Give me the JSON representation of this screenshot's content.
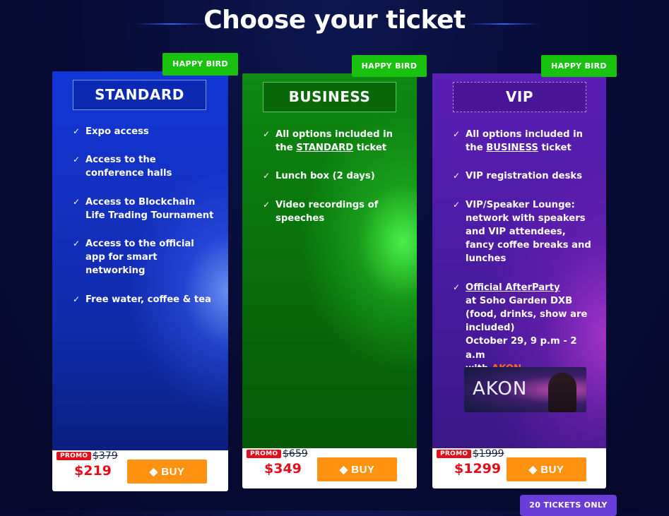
{
  "page": {
    "title": "Choose your ticket"
  },
  "badges": {
    "happy_bird": "HAPPY BIRD"
  },
  "tickets": [
    {
      "tier": "STANDARD",
      "features": [
        {
          "text": "Expo access"
        },
        {
          "text": "Access to the conference halls"
        },
        {
          "text": "Access to Blockchain Life Trading Tournament"
        },
        {
          "text": "Access to the official app for smart networking"
        },
        {
          "text": "Free water, coffee & tea"
        }
      ],
      "promo_label": "PROMO",
      "old_price": "$379",
      "price": "$219",
      "buy_label": "BUY"
    },
    {
      "tier": "BUSINESS",
      "features": [
        {
          "pre": "All options included in the ",
          "link": "STANDARD",
          "post": " ticket"
        },
        {
          "text": "Lunch box (2 days)"
        },
        {
          "text": "Video recordings of speeches"
        }
      ],
      "promo_label": "PROMO",
      "old_price": "$659",
      "price": "$349",
      "buy_label": "BUY"
    },
    {
      "tier": "VIP",
      "features": [
        {
          "pre": "All options included in the ",
          "link": "BUSINESS",
          "post": " ticket"
        },
        {
          "text": "VIP registration desks"
        },
        {
          "strong": "VIP/Speaker Lounge",
          "rest": ": network with speakers and VIP attendees, fancy coffee breaks and lunches"
        },
        {
          "afterparty_link": "Official AfterParty",
          "afterparty_venue": "at Soho Garden DXB",
          "afterparty_note": "(food, drinks, show are included)",
          "afterparty_date": "October 29, 9 p.m - 2 a.m",
          "afterparty_with": "with ",
          "afterparty_artist": "AKON"
        }
      ],
      "artist_image_text": "AKON",
      "promo_label": "PROMO",
      "old_price": "$1999",
      "price": "$1299",
      "buy_label": "BUY"
    }
  ],
  "footer_badge": "20 TICKETS ONLY",
  "colors": {
    "background": "#070b33",
    "standard": "#1430c0",
    "business": "#0b7a0e",
    "vip": "#4f1ca8",
    "badge_green": "#19c20f",
    "buy_orange": "#ff9210",
    "price_red": "#e20f1a",
    "footer_badge": "#6a3cd8"
  },
  "icons": {
    "check": "check-icon",
    "ticket": "ticket-icon"
  }
}
